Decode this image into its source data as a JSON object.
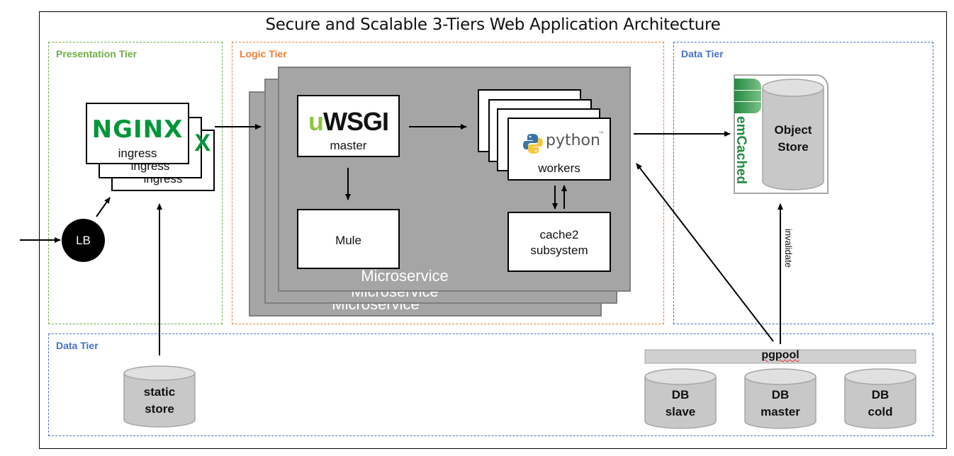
{
  "title": "Secure and Scalable 3-Tiers Web Application Architecture",
  "tiers": {
    "presentation": "Presentation Tier",
    "logic": "Logic Tier",
    "data_right": "Data Tier",
    "data_bottom": "Data Tier"
  },
  "colors": {
    "presentation": "#70ad47",
    "logic": "#ed7d31",
    "data": "#4472c4",
    "nginx_green": "#009639",
    "uwsgi_green": "#8dc63f",
    "memcached_green": "#218a3f",
    "microservice_gray": "#a5a5a5"
  },
  "load_balancer": {
    "label": "LB",
    "icon": "load-balancer-circle"
  },
  "ingress": {
    "logo": "NGINX",
    "logo_icon": "nginx-logo",
    "label": "ingress",
    "instances": 3
  },
  "microservice": {
    "label": "Microservice",
    "instances": 3,
    "master": {
      "logo_prefix": "u",
      "logo_text": "WSGI",
      "logo_icon": "uwsgi-logo",
      "label": "master"
    },
    "mule": {
      "label": "Mule"
    },
    "workers": {
      "logo_text": "python",
      "logo_icon": "python-logo",
      "trademark": "™",
      "label": "workers",
      "instances": 4
    },
    "cache": {
      "line1": "cache2",
      "line2": "subsystem"
    }
  },
  "object_store": {
    "line1": "Object",
    "line2": "Store",
    "memcached_text": "emCached",
    "memcached_icon": "memcached-logo"
  },
  "invalidate_label": "invalidate",
  "static_store": {
    "line1": "static",
    "line2": "store"
  },
  "pgpool": {
    "label": "pgpool"
  },
  "databases": [
    {
      "line1": "DB",
      "line2": "slave"
    },
    {
      "line1": "DB",
      "line2": "master"
    },
    {
      "line1": "DB",
      "line2": "cold"
    }
  ]
}
